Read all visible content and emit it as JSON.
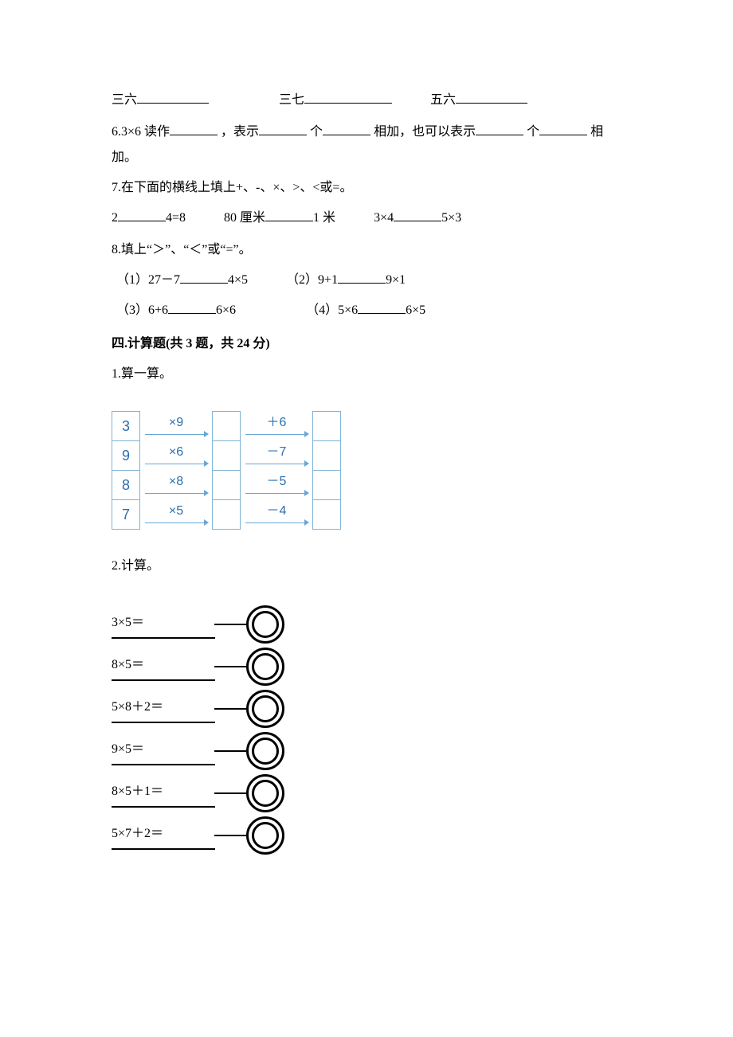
{
  "line1": {
    "a": "三六",
    "b": "三七",
    "c": "五六"
  },
  "q6": {
    "prefix": "6.3×6 读作",
    "mid1": "，表示",
    "mid2": "个",
    "mid3": "相加，也可以表示",
    "mid4": "个",
    "mid5": "相",
    "tail": "加。"
  },
  "q7": {
    "title": "7.在下面的横线上填上+、-、×、>、<或=。",
    "a_left": "2",
    "a_right": "4=8",
    "b_left": "80 厘米",
    "b_right": "1 米",
    "c_left": "3×4",
    "c_right": "5×3"
  },
  "q8": {
    "title": "8.填上“＞”、“＜”或“=”。",
    "r1a_left": "（1）27－7",
    "r1a_right": "4×5",
    "r1b_left": "（2）9+1",
    "r1b_right": "9×1",
    "r2a_left": "（3）6+6",
    "r2a_right": "6×6",
    "r2b_left": "（4）5×6",
    "r2b_right": "6×5"
  },
  "section4": "四.计算题(共 3 题，共 24 分)",
  "q4_1": {
    "title": "1.算一算。",
    "rows": [
      {
        "n": "3",
        "op1": "×9",
        "op2": "＋6"
      },
      {
        "n": "9",
        "op1": "×6",
        "op2": "－7"
      },
      {
        "n": "8",
        "op1": "×8",
        "op2": "－5"
      },
      {
        "n": "7",
        "op1": "×5",
        "op2": "－4"
      }
    ]
  },
  "q4_2": {
    "title": "2.计算。",
    "items": [
      "3×5＝",
      "8×5＝",
      "5×8＋2＝",
      "9×5＝",
      "8×5＋1＝",
      "5×7＋2＝"
    ]
  }
}
